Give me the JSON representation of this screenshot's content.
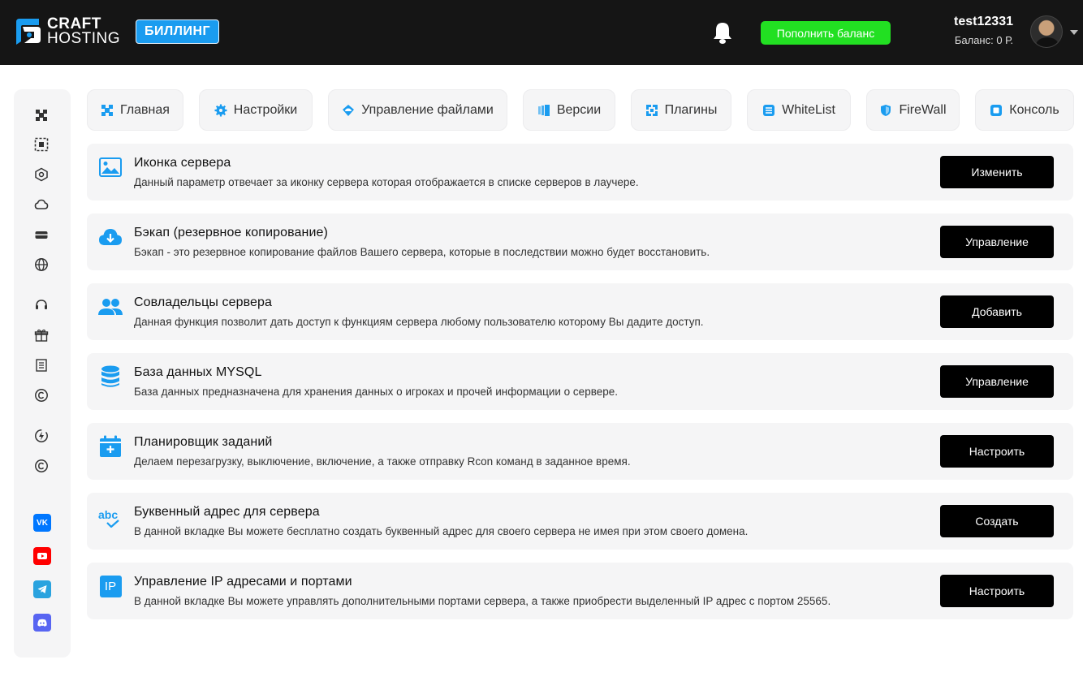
{
  "header": {
    "logo_line1": "CRAFT",
    "logo_line2": "HOSTING",
    "billing_badge": "БИЛЛИНГ",
    "topup_button": "Пополнить баланс",
    "username": "test12331",
    "balance": "Баланс: 0 Р."
  },
  "tabs": [
    {
      "label": "Главная",
      "icon": "home-icon"
    },
    {
      "label": "Настройки",
      "icon": "gear-icon"
    },
    {
      "label": "Управление файлами",
      "icon": "folder-cloud-icon"
    },
    {
      "label": "Версии",
      "icon": "versions-icon"
    },
    {
      "label": "Плагины",
      "icon": "plugins-icon"
    },
    {
      "label": "WhiteList",
      "icon": "list-icon"
    },
    {
      "label": "FireWall",
      "icon": "shield-icon"
    },
    {
      "label": "Консоль",
      "icon": "console-icon"
    }
  ],
  "rows": [
    {
      "title": "Иконка сервера",
      "desc": "Данный параметр отвечает за иконку сервера которая отображается в списке серверов в лаучере.",
      "button": "Изменить",
      "icon": "image-icon"
    },
    {
      "title": "Бэкап (резервное копирование)",
      "desc": "Бэкап - это резервное копирование файлов Вашего сервера, которые в последствии можно будет восстановить.",
      "button": "Управление",
      "icon": "cloud-download-icon"
    },
    {
      "title": "Совладельцы сервера",
      "desc": "Данная функция позволит дать доступ к функциям сервера любому пользователю которому Вы дадите доступ.",
      "button": "Добавить",
      "icon": "users-icon"
    },
    {
      "title": "База данных MYSQL",
      "desc": "База данных предназначена для хранения данных о игроках и прочей информации о сервере.",
      "button": "Управление",
      "icon": "database-icon"
    },
    {
      "title": "Планировщик заданий",
      "desc": "Делаем перезагрузку, выключение, включение, а также отправку Rcon команд в заданное время.",
      "button": "Настроить",
      "icon": "calendar-plus-icon"
    },
    {
      "title": "Буквенный адрес для сервера",
      "desc": "В данной вкладке Вы можете бесплатно создать буквенный адрес для своего сервера не имея при этом своего домена.",
      "button": "Создать",
      "icon": "abc-check-icon",
      "icon_text": "abc"
    },
    {
      "title": "Управление IP адресами и портами",
      "desc": "В данной вкладке Вы можете управлять дополнительными портами сервера, а также приобрести выделенный IP адрес с портом 25565.",
      "button": "Настроить",
      "icon": "ip-icon",
      "icon_text": "IP"
    }
  ],
  "sidebar_social": [
    {
      "icon": "vk-icon",
      "text": "VK",
      "color": "#0077ff"
    },
    {
      "icon": "youtube-icon",
      "color": "#ff0000"
    },
    {
      "icon": "telegram-icon",
      "color": "#2aa3df"
    },
    {
      "icon": "discord-icon",
      "color": "#5865f2"
    }
  ],
  "colors": {
    "accent": "#1a9cf0",
    "topup": "#22e022",
    "header_bg": "#151515"
  }
}
